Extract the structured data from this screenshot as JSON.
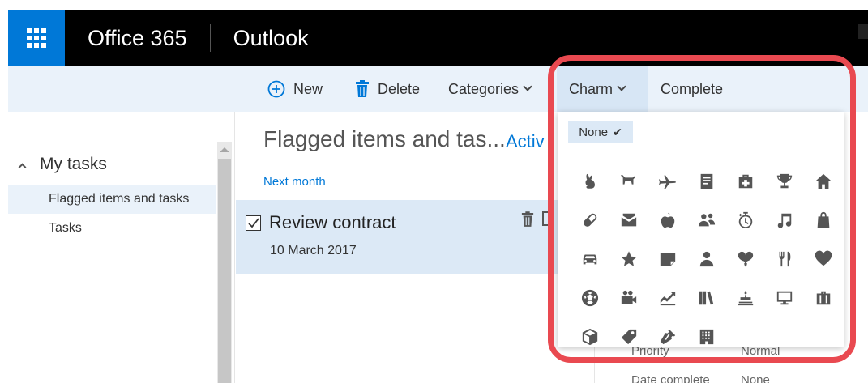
{
  "suite": {
    "brand": "Office 365",
    "app": "Outlook"
  },
  "toolbar": {
    "new_label": "New",
    "delete_label": "Delete",
    "categories_label": "Categories",
    "charm_label": "Charm",
    "complete_label": "Complete"
  },
  "nav": {
    "section": "My tasks",
    "items": [
      {
        "label": "Flagged items and tasks",
        "selected": true
      },
      {
        "label": "Tasks",
        "selected": false
      }
    ]
  },
  "list": {
    "title": "Flagged items and tas...",
    "filter": "Activ",
    "group": "Next month",
    "tasks": [
      {
        "title": "Review contract",
        "date": "10 March 2017",
        "checked": true
      }
    ]
  },
  "details": {
    "priority_label": "Priority",
    "priority_value": "Normal",
    "date_complete_label": "Date complete",
    "date_complete_value": "None"
  },
  "charm_menu": {
    "none_label": "None",
    "icons": [
      "rabbit-icon",
      "dog-icon",
      "airplane-icon",
      "document-icon",
      "first-aid-icon",
      "trophy-icon",
      "home-icon",
      "pill-icon",
      "envelope-icon",
      "apple-icon",
      "people-icon",
      "stopwatch-icon",
      "music-note-icon",
      "shopping-bag-icon",
      "car-icon",
      "star-icon",
      "sticky-note-icon",
      "person-icon",
      "balloon-icon",
      "fork-knife-icon",
      "heart-icon",
      "soccer-ball-icon",
      "video-camera-icon",
      "chart-icon",
      "books-icon",
      "birthday-cake-icon",
      "monitor-icon",
      "briefcase-icon",
      "package-icon",
      "tag-icon",
      "ticket-icon",
      "building-icon"
    ]
  },
  "colors": {
    "accent": "#0078d7",
    "suite_bar": "#000000",
    "command_bar": "#eaf2fa",
    "selected": "#dce9f6",
    "highlight_ring": "#e94950"
  }
}
